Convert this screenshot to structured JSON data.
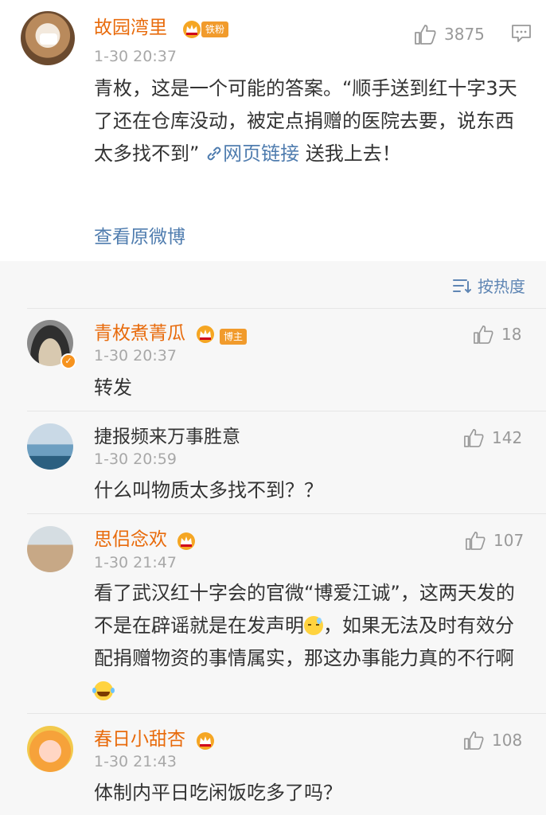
{
  "main_post": {
    "username": "故园湾里",
    "badge": "铁粉",
    "time": "1-30 20:37",
    "like_count": "3875",
    "text_before_link": "青枚，这是一个可能的答案。“顺手送到红十字3天了还在仓库没动，被定点捐赠的医院去要，说东西太多找不到”",
    "link_label": "网页链接",
    "text_after_link": "送我上去！",
    "view_original": "查看原微博"
  },
  "sort_label": "按热度",
  "comments": [
    {
      "username": "青枚煮菁瓜",
      "badge": "博主",
      "time": "1-30 20:37",
      "likes": "18",
      "text": "转发"
    },
    {
      "username": "捷报频来万事胜意",
      "time": "1-30 20:59",
      "likes": "142",
      "text": "什么叫物质太多找不到？？"
    },
    {
      "username": "思侣念欢",
      "time": "1-30 21:47",
      "likes": "107",
      "text_part1": "看了武汉红十字会的官微“博爱江诚”，这两天发的不是在辟谣就是在发声明",
      "text_part2": "，如果无法及时有效分配捐赠物资的事情属实，那这办事能力真的不行啊"
    },
    {
      "username": "春日小甜杏",
      "time": "1-30 21:43",
      "likes": "108",
      "text": "体制内平日吃闲饭吃多了吗？"
    }
  ],
  "colors": {
    "name_orange": "#e86b0c",
    "link_blue": "#507daf",
    "badge_orange": "#f19b2c"
  }
}
